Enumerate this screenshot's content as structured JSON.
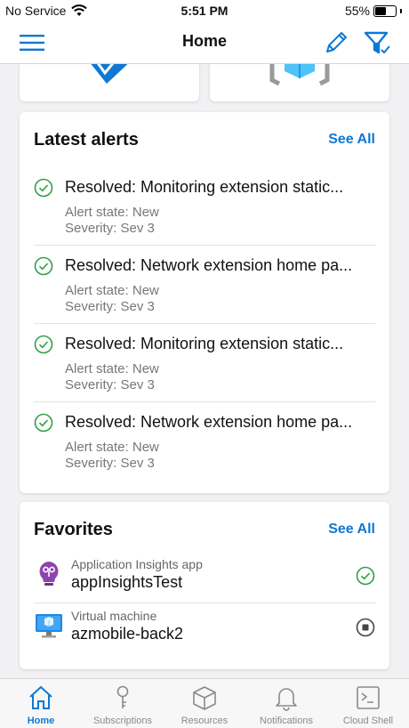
{
  "status": {
    "carrier": "No Service",
    "time": "5:51 PM",
    "battery": "55%",
    "battery_level": 0.55
  },
  "nav": {
    "title": "Home"
  },
  "alerts": {
    "title": "Latest alerts",
    "see_all": "See All",
    "items": [
      {
        "title": "Resolved: Monitoring extension static...",
        "state": "Alert state: New",
        "severity": "Severity: Sev 3"
      },
      {
        "title": "Resolved: Network extension home pa...",
        "state": "Alert state: New",
        "severity": "Severity: Sev 3"
      },
      {
        "title": "Resolved: Monitoring extension static...",
        "state": "Alert state: New",
        "severity": "Severity: Sev 3"
      },
      {
        "title": "Resolved: Network extension home pa...",
        "state": "Alert state: New",
        "severity": "Severity: Sev 3"
      }
    ]
  },
  "favorites": {
    "title": "Favorites",
    "see_all": "See All",
    "items": [
      {
        "type": "Application Insights app",
        "name": "appInsightsTest",
        "status_icon": "check-circle-icon"
      },
      {
        "type": "Virtual machine",
        "name": "azmobile-back2",
        "status_icon": "stopped-circle-icon"
      }
    ]
  },
  "tabs": [
    {
      "label": "Home",
      "icon": "home-icon",
      "active": true
    },
    {
      "label": "Subscriptions",
      "icon": "key-icon",
      "active": false
    },
    {
      "label": "Resources",
      "icon": "cube-icon",
      "active": false
    },
    {
      "label": "Notifications",
      "icon": "bell-icon",
      "active": false
    },
    {
      "label": "Cloud Shell",
      "icon": "terminal-icon",
      "active": false
    }
  ],
  "colors": {
    "accent": "#0f78d4",
    "success": "#2ea043",
    "text_secondary": "#777777"
  }
}
